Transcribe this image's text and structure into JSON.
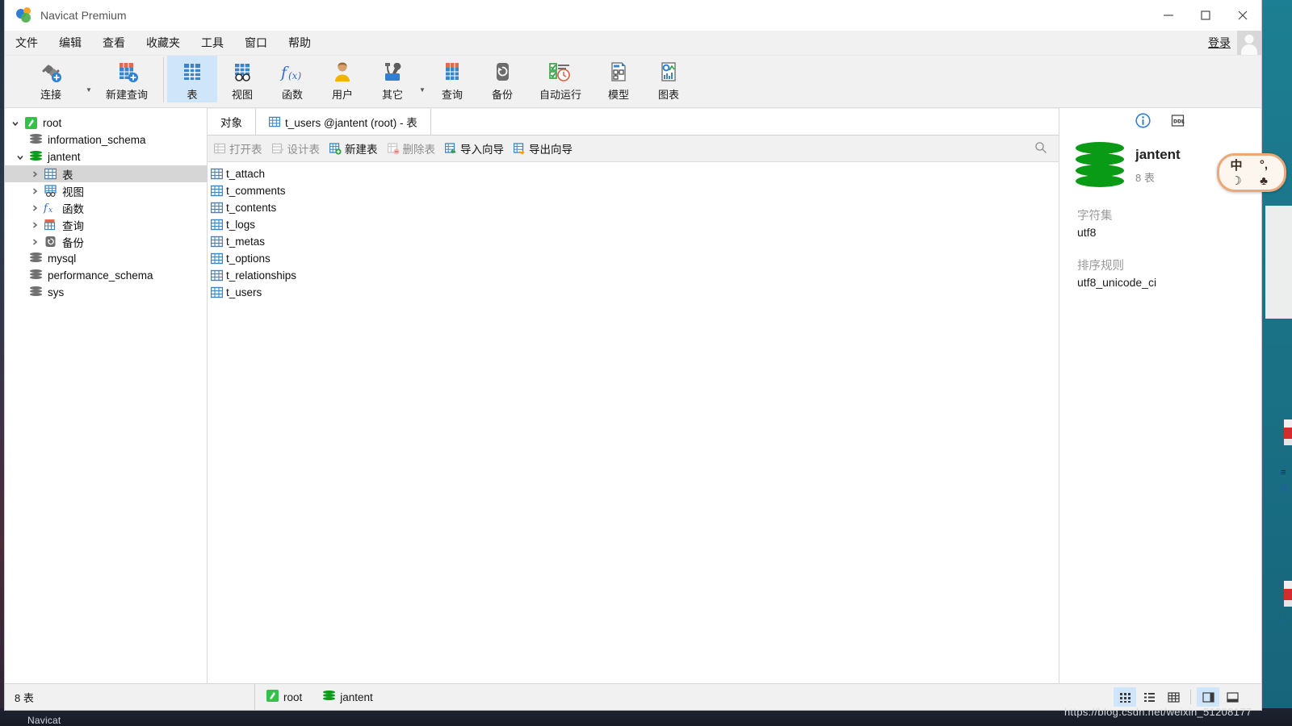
{
  "window": {
    "title": "Navicat Premium",
    "logo_icon": "navicat-logo-icon",
    "minimize_icon": "minimize-icon",
    "maximize_icon": "maximize-icon",
    "close_icon": "close-icon"
  },
  "menubar": {
    "items": [
      {
        "label": "文件",
        "name": "menu-file"
      },
      {
        "label": "编辑",
        "name": "menu-edit"
      },
      {
        "label": "查看",
        "name": "menu-view"
      },
      {
        "label": "收藏夹",
        "name": "menu-favorites"
      },
      {
        "label": "工具",
        "name": "menu-tools"
      },
      {
        "label": "窗口",
        "name": "menu-window"
      },
      {
        "label": "帮助",
        "name": "menu-help"
      }
    ],
    "login_label": "登录",
    "avatar_icon": "user-avatar-icon"
  },
  "toolbar": {
    "items": [
      {
        "label": "连接",
        "name": "toolbar-connection",
        "icon": "connection-plug-icon",
        "active": false,
        "caret": true
      },
      {
        "label": "新建查询",
        "name": "toolbar-new-query",
        "icon": "new-query-icon",
        "active": false,
        "caret": false
      },
      {
        "label": "表",
        "name": "toolbar-table",
        "icon": "table-grid-icon",
        "active": true,
        "caret": false
      },
      {
        "label": "视图",
        "name": "toolbar-view",
        "icon": "view-glasses-icon",
        "active": false,
        "caret": false
      },
      {
        "label": "函数",
        "name": "toolbar-function",
        "icon": "function-fx-icon",
        "active": false,
        "caret": false
      },
      {
        "label": "用户",
        "name": "toolbar-user",
        "icon": "user-person-icon",
        "active": false,
        "caret": false
      },
      {
        "label": "其它",
        "name": "toolbar-other",
        "icon": "tools-wrench-icon",
        "active": false,
        "caret": true
      },
      {
        "label": "查询",
        "name": "toolbar-query",
        "icon": "query-icon",
        "active": false,
        "caret": false
      },
      {
        "label": "备份",
        "name": "toolbar-backup",
        "icon": "backup-restore-icon",
        "active": false,
        "caret": false
      },
      {
        "label": "自动运行",
        "name": "toolbar-automation",
        "icon": "automation-clock-icon",
        "active": false,
        "caret": false
      },
      {
        "label": "模型",
        "name": "toolbar-model",
        "icon": "model-diagram-icon",
        "active": false,
        "caret": false
      },
      {
        "label": "图表",
        "name": "toolbar-chart",
        "icon": "chart-report-icon",
        "active": false,
        "caret": false
      }
    ]
  },
  "sidebar": {
    "tree": [
      {
        "label": "root",
        "name": "tree-connection-root",
        "icon": "navicat-conn-icon",
        "level": 0,
        "twisty": "down",
        "selected": false
      },
      {
        "label": "information_schema",
        "name": "tree-db-information-schema",
        "icon": "database-gray-icon",
        "level": 1,
        "twisty": "none",
        "selected": false
      },
      {
        "label": "jantent",
        "name": "tree-db-jantent",
        "icon": "database-green-icon",
        "level": 1,
        "twisty": "down",
        "selected": false
      },
      {
        "label": "表",
        "name": "tree-node-tables",
        "icon": "table-grid-icon",
        "level": 2,
        "twisty": "right",
        "selected": true
      },
      {
        "label": "视图",
        "name": "tree-node-views",
        "icon": "view-glasses-icon",
        "level": 2,
        "twisty": "right",
        "selected": false
      },
      {
        "label": "函数",
        "name": "tree-node-functions",
        "icon": "function-fx-icon",
        "level": 2,
        "twisty": "right",
        "selected": false
      },
      {
        "label": "查询",
        "name": "tree-node-queries",
        "icon": "query-icon",
        "level": 2,
        "twisty": "right",
        "selected": false
      },
      {
        "label": "备份",
        "name": "tree-node-backups",
        "icon": "backup-restore-icon",
        "level": 2,
        "twisty": "right",
        "selected": false
      },
      {
        "label": "mysql",
        "name": "tree-db-mysql",
        "icon": "database-gray-icon",
        "level": 1,
        "twisty": "none",
        "selected": false
      },
      {
        "label": "performance_schema",
        "name": "tree-db-performance-schema",
        "icon": "database-gray-icon",
        "level": 1,
        "twisty": "none",
        "selected": false
      },
      {
        "label": "sys",
        "name": "tree-db-sys",
        "icon": "database-gray-icon",
        "level": 1,
        "twisty": "none",
        "selected": false
      }
    ]
  },
  "tabs": [
    {
      "label": "对象",
      "name": "tab-objects",
      "icon": "none",
      "active": true
    },
    {
      "label": "t_users @jantent (root) - 表",
      "name": "tab-t-users",
      "icon": "table-grid-icon",
      "active": false
    }
  ],
  "objectbar": {
    "buttons": [
      {
        "label": "打开表",
        "name": "open-table-button",
        "icon": "open-table-icon",
        "disabled": true
      },
      {
        "label": "设计表",
        "name": "design-table-button",
        "icon": "design-table-icon",
        "disabled": true
      },
      {
        "label": "新建表",
        "name": "new-table-button",
        "icon": "new-table-icon",
        "disabled": false
      },
      {
        "label": "删除表",
        "name": "delete-table-button",
        "icon": "delete-table-icon",
        "disabled": true
      },
      {
        "label": "导入向导",
        "name": "import-wizard-button",
        "icon": "import-wizard-icon",
        "disabled": false
      },
      {
        "label": "导出向导",
        "name": "export-wizard-button",
        "icon": "export-wizard-icon",
        "disabled": false
      }
    ],
    "search_icon": "search-icon"
  },
  "objectlist": {
    "rows": [
      {
        "name": "t_attach",
        "icon": "table-grid-icon"
      },
      {
        "name": "t_comments",
        "icon": "table-grid-icon"
      },
      {
        "name": "t_contents",
        "icon": "table-grid-icon"
      },
      {
        "name": "t_logs",
        "icon": "table-grid-icon"
      },
      {
        "name": "t_metas",
        "icon": "table-grid-icon"
      },
      {
        "name": "t_options",
        "icon": "table-grid-icon"
      },
      {
        "name": "t_relationships",
        "icon": "table-grid-icon"
      },
      {
        "name": "t_users",
        "icon": "table-grid-icon"
      }
    ]
  },
  "infopanel": {
    "info_icon": "info-circle-icon",
    "ddl_icon": "ddl-icon",
    "db_icon": "database-green-large-icon",
    "db_name": "jantent",
    "db_sub": "8 表",
    "charset_label": "字符集",
    "charset_value": "utf8",
    "collation_label": "排序规则",
    "collation_value": "utf8_unicode_ci"
  },
  "statusbar": {
    "count_label": "8 表",
    "connection_icon": "navicat-conn-icon",
    "connection_name": "root",
    "database_icon": "database-green-icon",
    "database_name": "jantent",
    "view_modes": [
      {
        "name": "view-mode-grid",
        "icon": "grid-view-icon",
        "active": true
      },
      {
        "name": "view-mode-list",
        "icon": "list-view-icon",
        "active": false
      },
      {
        "name": "view-mode-detail",
        "icon": "detail-view-icon",
        "active": false
      },
      {
        "name": "view-mode-preview-right",
        "icon": "preview-right-icon",
        "active": true
      },
      {
        "name": "view-mode-preview-bottom",
        "icon": "preview-bottom-icon",
        "active": false
      }
    ]
  },
  "overlays": {
    "watermark": "https://blog.csdn.net/weixin_51208177",
    "ime_chars": [
      "中",
      "°,",
      "☽",
      "♣"
    ],
    "taskbar_label": "Navicat"
  },
  "colors": {
    "accent_blue": "#2f7fd4",
    "active_tab_blue": "#cfe6fa",
    "db_green": "#0a9b16",
    "selection_gray": "#d6d6d6",
    "chrome_gray": "#f1f1f1",
    "desktop_teal": "#1a7286"
  }
}
